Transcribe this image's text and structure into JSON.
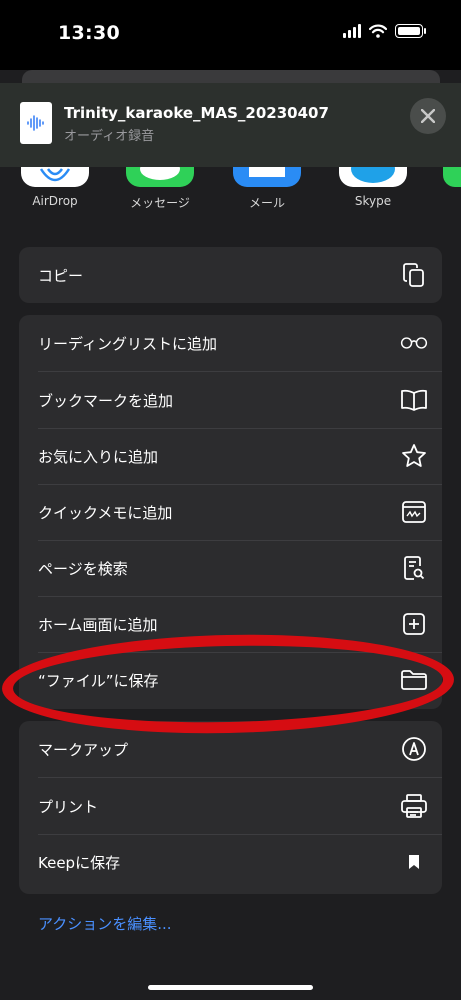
{
  "status_bar": {
    "time": "13:30"
  },
  "file": {
    "title": "Trinity_karaoke_MAS_20230407",
    "subtitle": "オーディオ録音"
  },
  "apps": [
    {
      "label": "AirDrop",
      "color": "#ffffff"
    },
    {
      "label": "メッセージ",
      "color": "#2fd158"
    },
    {
      "label": "メール",
      "color": "#2a8cf5"
    },
    {
      "label": "Skype",
      "color": "#ffffff"
    }
  ],
  "group1": [
    {
      "label": "コピー",
      "icon": "copy-icon"
    }
  ],
  "group2": [
    {
      "label": "リーディングリストに追加",
      "icon": "glasses-icon"
    },
    {
      "label": "ブックマークを追加",
      "icon": "book-icon"
    },
    {
      "label": "お気に入りに追加",
      "icon": "star-icon"
    },
    {
      "label": "クイックメモに追加",
      "icon": "quick-note-icon"
    },
    {
      "label": "ページを検索",
      "icon": "find-page-icon"
    },
    {
      "label": "ホーム画面に追加",
      "icon": "add-square-icon"
    },
    {
      "label": "“ファイル”に保存",
      "icon": "folder-icon"
    }
  ],
  "group3": [
    {
      "label": "マークアップ",
      "icon": "markup-icon"
    },
    {
      "label": "プリント",
      "icon": "printer-icon"
    },
    {
      "label": "Keepに保存",
      "icon": "bookmark-icon"
    }
  ],
  "edit_actions": "アクションを編集...",
  "colors": {
    "highlight": "#d60d12",
    "link": "#4a90ff"
  }
}
